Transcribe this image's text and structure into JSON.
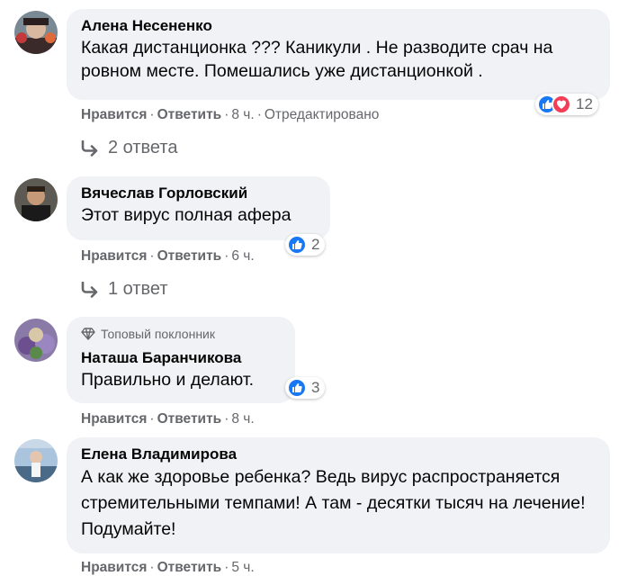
{
  "comments": [
    {
      "author": "Алена Несененко",
      "text": "Какая дистанционка ??? Каникули . Не разводите срач на ровном месте. Помешались уже дистанционкой .",
      "like": "Нравится",
      "reply": "Ответить",
      "time": "8 ч.",
      "edited": "Отредактировано",
      "reaction_count": "12",
      "replies": "2 ответа"
    },
    {
      "author": "Вячеслав Горловский",
      "text": "Этот вирус полная афера",
      "like": "Нравится",
      "reply": "Ответить",
      "time": "6 ч.",
      "reaction_count": "2",
      "replies": "1 ответ"
    },
    {
      "badge": "Топовый поклонник",
      "author": "Наташа Баранчикова",
      "text": "Правильно и делают.",
      "like": "Нравится",
      "reply": "Ответить",
      "time": "8 ч.",
      "reaction_count": "3"
    },
    {
      "author": "Елена Владимирова",
      "text": "А как же здоровье ребенка? Ведь вирус распространяется стремительными темпами! А там - десятки тысяч на лечение! Подумайте!",
      "like": "Нравится",
      "reply": "Ответить",
      "time": "5 ч."
    }
  ],
  "colors": {
    "like_blue": "#1877f2",
    "love_red": "#f33e58",
    "bubble": "#f0f2f5",
    "meta": "#65676b"
  }
}
